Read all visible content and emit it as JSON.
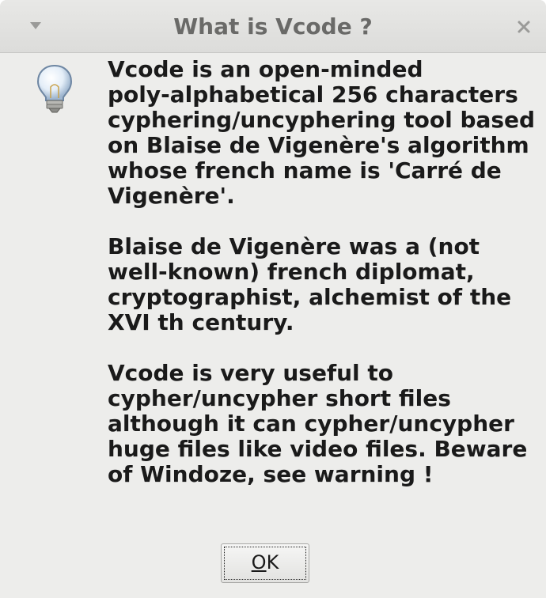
{
  "window": {
    "title": "What is Vcode ?",
    "close_icon": "close-icon",
    "menu_icon": "chevron-down-icon"
  },
  "dialog": {
    "icon": "lightbulb-icon",
    "paragraphs": [
      "Vcode is an open-minded\npoly-alphabetical 256 characters\ncyphering/uncyphering tool based\non Blaise de Vigenère's algorithm\nwhose french name is 'Carré de\nVigenère'.",
      "Blaise de Vigenère was a (not\nwell-known) french diplomat,\ncryptographist, alchemist of the\nXVI th century.",
      "Vcode is very useful to\ncypher/uncypher short files\nalthough it can cypher/uncypher\nhuge files like video files. Beware\nof Windoze, see warning !"
    ]
  },
  "buttons": {
    "ok_mnemonic": "O",
    "ok_rest": "K"
  },
  "colors": {
    "background": "#ededeb",
    "title_text": "#6a6a68",
    "body_text": "#1a1a1a"
  }
}
